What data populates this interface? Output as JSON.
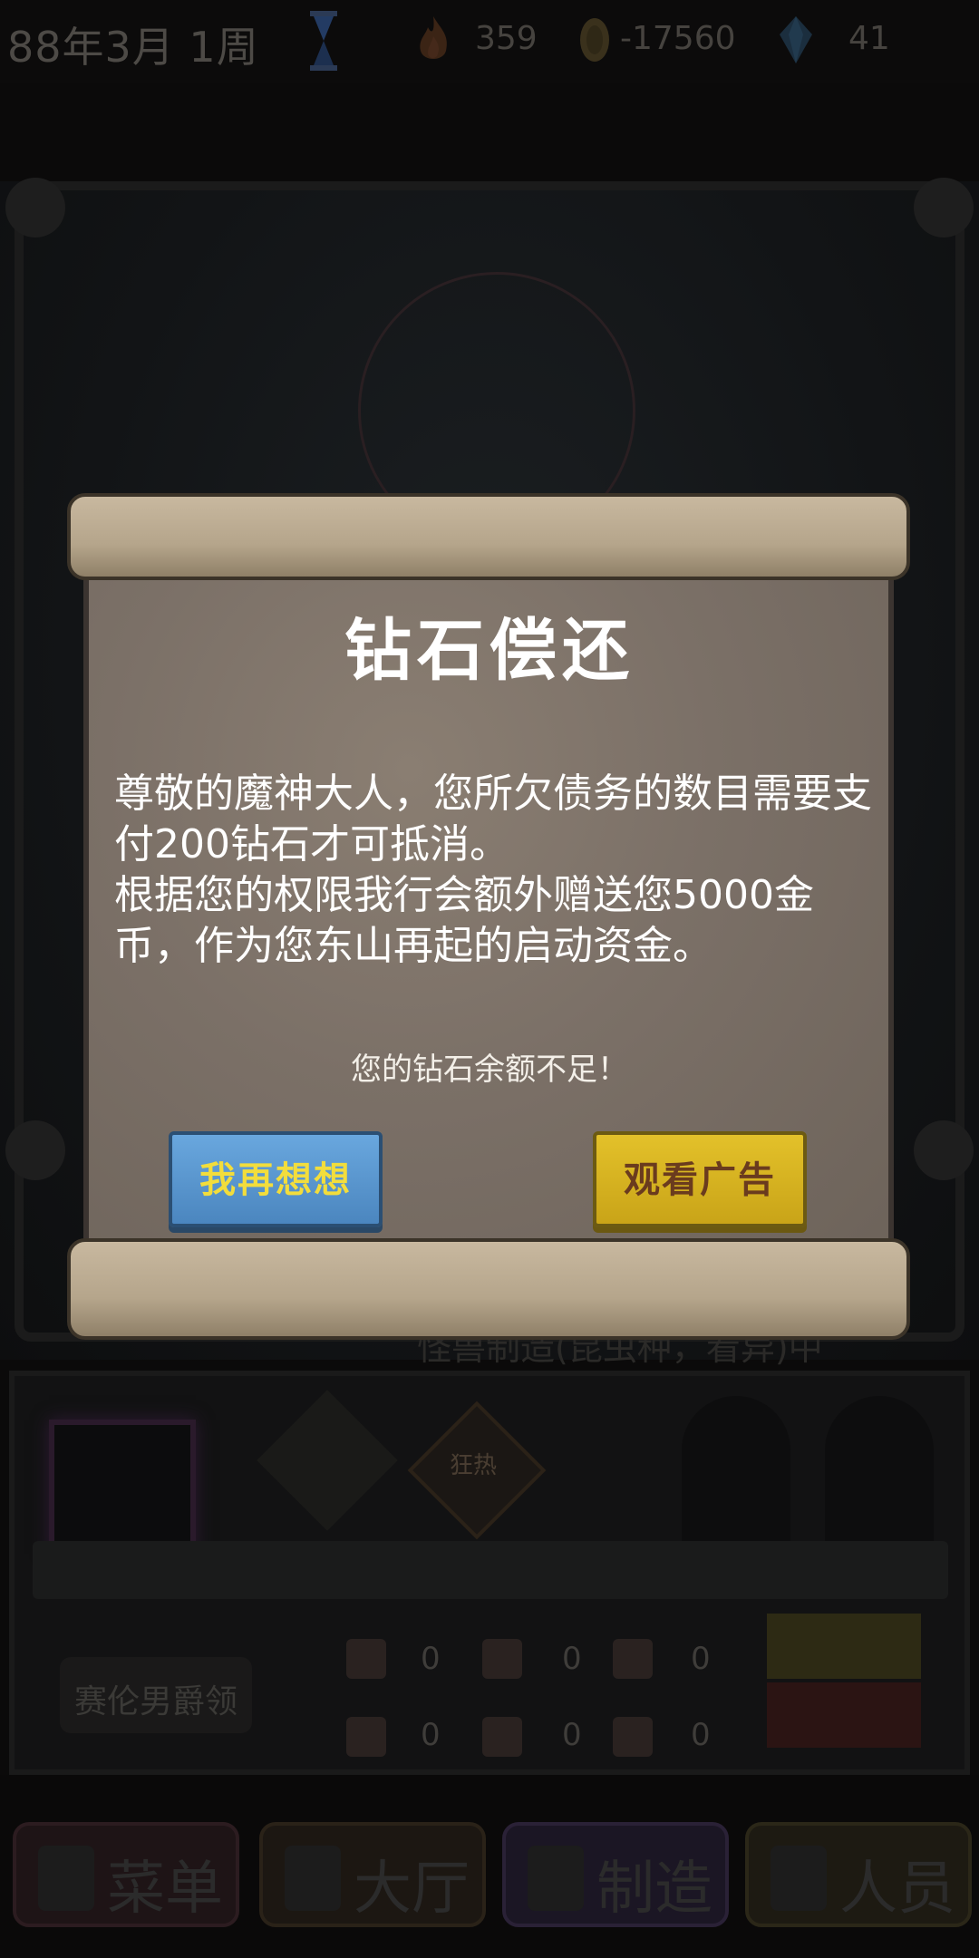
{
  "status_bar": {
    "date": "88年3月 1周",
    "flame_value": "359",
    "coin_value": "-17560",
    "gem_value": "41"
  },
  "background": {
    "banner_text": "怪兽制造(昆虫种，看异)中",
    "trait_label": "狂热",
    "title_button": "赛伦男爵领",
    "resources": [
      "0",
      "0",
      "0",
      "0",
      "0",
      "0"
    ]
  },
  "nav": {
    "menu": "菜单",
    "hall": "大厅",
    "craft": "制造",
    "staff": "人员"
  },
  "dialog": {
    "title": "钻石偿还",
    "body_line1": "尊敬的魔神大人，您所欠债务的数目需要支付200钻石才可抵消。",
    "body_line2": "根据您的权限我行会额外赠送您5000金币，作为您东山再起的启动资金。",
    "warning": "您的钻石余额不足！",
    "btn_reconsider": "我再想想",
    "btn_watch_ad": "观看广告"
  },
  "colors": {
    "reconsider_button": "#5b97cf",
    "watch_ad_button": "#d9b521",
    "button_text_yellow": "#f2dd3c"
  }
}
